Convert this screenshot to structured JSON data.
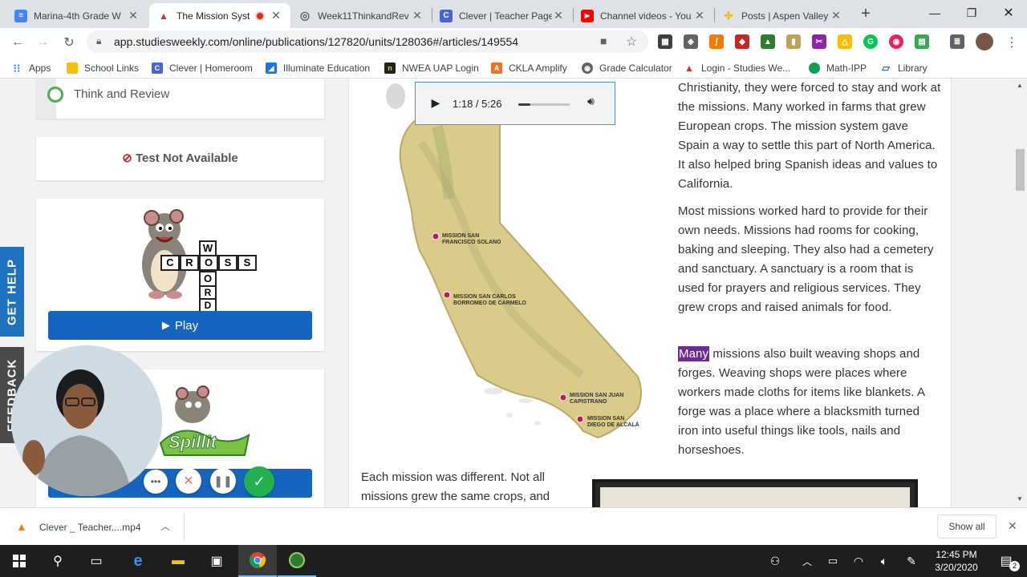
{
  "browser": {
    "tabs": [
      {
        "title": "Marina-4th Grade W",
        "color": "#4285f4",
        "glyph": "≡"
      },
      {
        "title": "The Mission Syst",
        "color": "#c0392b",
        "glyph": "▲"
      },
      {
        "title": "Week11ThinkandRev",
        "color": "#5f6368",
        "glyph": "◎"
      },
      {
        "title": "Clever | Teacher Page",
        "color": "#4a63d8",
        "glyph": "C"
      },
      {
        "title": "Channel videos - You",
        "color": "#ff0000",
        "glyph": "▶"
      },
      {
        "title": "Posts | Aspen Valley",
        "color": "#f4b400",
        "glyph": "✣"
      }
    ],
    "new_tab": "+",
    "url": "app.studiesweekly.com/online/publications/127820/units/128036#/articles/149554",
    "bookmarks": [
      {
        "label": "Apps",
        "color": "#4285f4",
        "glyph": "⋮"
      },
      {
        "label": "School Links",
        "color": "#f4c20d",
        "glyph": ""
      },
      {
        "label": "Clever | Homeroom",
        "color": "#4a63d8",
        "glyph": "C"
      },
      {
        "label": "Illuminate Education",
        "color": "#1a73e8",
        "glyph": "◢"
      },
      {
        "label": "NWEA UAP Login",
        "color": "#222222",
        "glyph": "n"
      },
      {
        "label": "CKLA Amplify",
        "color": "#f37021",
        "glyph": "A"
      },
      {
        "label": "Grade Calculator",
        "color": "#5f6368",
        "glyph": "◉"
      },
      {
        "label": "Login - Studies We...",
        "color": "#c0392b",
        "glyph": "▲"
      },
      {
        "label": "Math-IPP",
        "color": "#0f9d58",
        "glyph": "●"
      },
      {
        "label": "Library",
        "color": "#1a73e8",
        "glyph": "▱"
      }
    ]
  },
  "sidebar": {
    "think_review": "Think and Review",
    "test_status": "Test Not Available",
    "game1_play": "Play",
    "crossword_letters": [
      "C",
      "R",
      "O",
      "S",
      "S",
      "W",
      "O",
      "R",
      "D"
    ],
    "game2_word": "Spillit"
  },
  "side_tabs": {
    "help": "GET HELP",
    "feedback": "FEEDBACK"
  },
  "audio": {
    "time": "1:18 / 5:26",
    "progress": 0.24
  },
  "map": {
    "labels": [
      "MISSION SAN FRANCISCO SOLANO",
      "MISSION SAN CARLOS BORROMEO DE CARMELO",
      "MISSION SAN JUAN CAPISTRANO",
      "MISSION SAN DIEGO DE ALCALÁ"
    ]
  },
  "article": {
    "p1": "Christianity, they were forced to stay and work at the missions. Many worked in farms that grew European crops. The mission system gave Spain a way to settle this part of North America. It also helped bring Spanish ideas and values to California.",
    "p2": "Most missions worked hard to provide for their own needs. Missions had rooms for cooking, baking and sleeping. They also had a cemetery and sanctuary. A sanctuary is a room that is used for prayers and religious services. They grew crops and raised animals for food.",
    "p3_highlight": "Many",
    "p3_rest": " missions also built weaving shops and forges. Weaving shops were places where workers made cloths for items like blankets. A forge was a place where a blacksmith turned iron into useful things like tools, nails and horseshoes.",
    "p4": "Each mission was different. Not all missions grew the same crops, and"
  },
  "download": {
    "file": "Clever _ Teacher....mp4",
    "show_all": "Show all"
  },
  "taskbar": {
    "time": "12:45 PM",
    "date": "3/20/2020",
    "notif_count": "2"
  },
  "colors": {
    "brand_blue": "#1565c0",
    "highlight": "#6c2c91",
    "side_tab": "#1e73be"
  }
}
